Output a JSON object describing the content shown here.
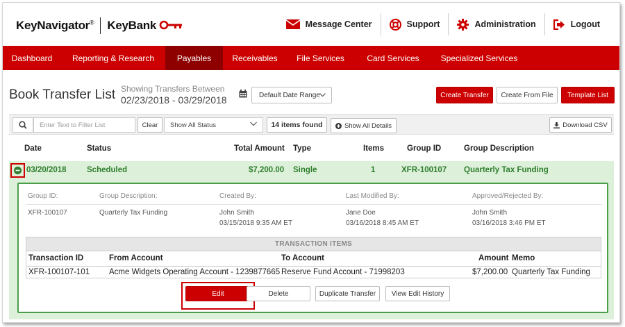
{
  "header": {
    "logo_keynavigator": "KeyNavigator",
    "logo_reg": "®",
    "logo_keybank": "KeyBank",
    "nav": [
      {
        "label": "Message Center",
        "icon": "envelope-icon"
      },
      {
        "label": "Support",
        "icon": "lifebuoy-icon"
      },
      {
        "label": "Administration",
        "icon": "gear-icon"
      },
      {
        "label": "Logout",
        "icon": "logout-icon"
      }
    ]
  },
  "mainnav": {
    "items": [
      "Dashboard",
      "Reporting & Research",
      "Payables",
      "Receivables",
      "File Services",
      "Card Services",
      "Specialized Services"
    ],
    "active_index": 2
  },
  "page": {
    "title": "Book Transfer List",
    "showing_label": "Showing Transfers Between",
    "date_range": "02/23/2018 - 03/29/2018",
    "date_range_select": "Default Date Range",
    "create_transfer": "Create Transfer",
    "create_from_file": "Create From File",
    "template_list": "Template List"
  },
  "filter": {
    "placeholder": "Enter Text to Filter List",
    "clear": "Clear",
    "status_select": "Show All Status",
    "items_found": "14 items found",
    "show_all_details": "Show All Details",
    "download_csv": "Download CSV"
  },
  "table": {
    "columns": [
      "Date",
      "Status",
      "Total Amount",
      "Type",
      "Items",
      "Group ID",
      "Group Description"
    ],
    "row": {
      "date": "03/20/2018",
      "status": "Scheduled",
      "total_amount": "$7,200.00",
      "type": "Single",
      "items": "1",
      "group_id": "XFR-100107",
      "group_description": "Quarterly Tax Funding"
    }
  },
  "detail": {
    "labels": {
      "group_id": "Group ID:",
      "group_description": "Group Description:",
      "created_by": "Created By:",
      "last_modified_by": "Last Modified By:",
      "approved_rejected_by": "Approved/Rejected By:"
    },
    "values": {
      "group_id": "XFR-100107",
      "group_description": "Quarterly Tax Funding",
      "created_by_name": "John Smith",
      "created_by_date": "03/15/2018 9:35 AM ET",
      "modified_by_name": "Jane Doe",
      "modified_by_date": "03/16/2018 8:45 AM ET",
      "approved_by_name": "John Smith",
      "approved_by_date": "03/16/2018 3:46 PM ET"
    },
    "transaction_items": {
      "title": "TRANSACTION ITEMS",
      "columns": [
        "Transaction ID",
        "From Account",
        "To Account",
        "Amount",
        "Memo"
      ],
      "row": {
        "transaction_id": "XFR-100107-101",
        "from_account": "Acme Widgets Operating Account - 1239877665",
        "to_account": "Reserve Fund Account - 71998203",
        "amount": "$7,200.00",
        "memo": "Quarterly Tax Funding"
      }
    },
    "actions": {
      "edit": "Edit",
      "delete": "Delete",
      "duplicate": "Duplicate Transfer",
      "history": "View Edit History"
    }
  },
  "colors": {
    "brand_red": "#cc0000",
    "active_nav": "#8e0000",
    "row_green_bg": "#ddf0d9",
    "row_green_text": "#2d7d2d"
  }
}
